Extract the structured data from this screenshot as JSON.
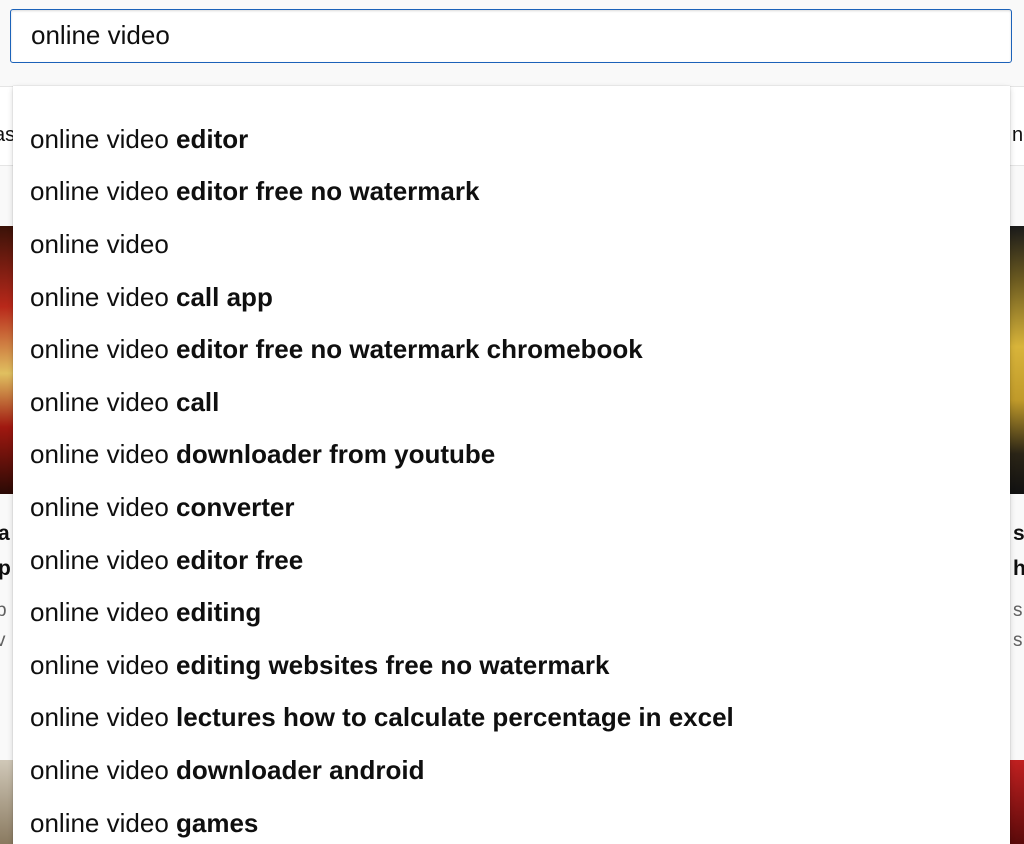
{
  "search": {
    "value": "online video",
    "placeholder": ""
  },
  "background": {
    "chip_left": "as",
    "chip_right": "ng",
    "left_title_1": "a",
    "left_title_2": "p",
    "left_meta_1": "p",
    "left_meta_2": "v",
    "right_title_1": "s",
    "right_title_2": "h",
    "right_meta_1": "s",
    "right_meta_2": "s"
  },
  "suggestions": [
    {
      "typed": "online video",
      "completion": "editor"
    },
    {
      "typed": "online video",
      "completion": "editor free no watermark"
    },
    {
      "typed": "online video",
      "completion": ""
    },
    {
      "typed": "online video",
      "completion": "call app"
    },
    {
      "typed": "online video",
      "completion": "editor free no watermark chromebook"
    },
    {
      "typed": "online video",
      "completion": "call"
    },
    {
      "typed": "online video",
      "completion": "downloader from youtube"
    },
    {
      "typed": "online video",
      "completion": "converter"
    },
    {
      "typed": "online video",
      "completion": "editor free"
    },
    {
      "typed": "online video",
      "completion": "editing"
    },
    {
      "typed": "online video",
      "completion": "editing websites free no watermark"
    },
    {
      "typed": "online video",
      "completion": "lectures how to calculate percentage in excel"
    },
    {
      "typed": "online video",
      "completion": "downloader android"
    },
    {
      "typed": "online video",
      "completion": "games"
    }
  ]
}
